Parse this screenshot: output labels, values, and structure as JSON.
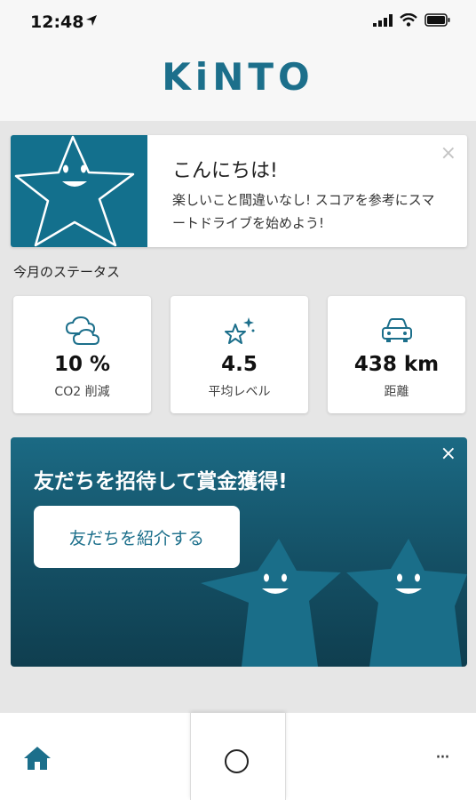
{
  "status_bar": {
    "time": "12:48"
  },
  "header": {
    "logo": "KiNTO"
  },
  "greeting": {
    "title": "こんにちは!",
    "message": "楽しいこと間違いなし! スコアを参考にスマートドライブを始めよう!",
    "close": "×"
  },
  "status": {
    "heading": "今月のステータス",
    "cards": [
      {
        "icon": "cloud-icon",
        "value": "10 %",
        "label": "CO2 削減"
      },
      {
        "icon": "sparkle-star-icon",
        "value": "4.5",
        "label": "平均レベル"
      },
      {
        "icon": "car-icon",
        "value": "438 km",
        "label": "距離"
      }
    ]
  },
  "invite": {
    "title": "友だちを招待して賞金獲得!",
    "button_label": "友だちを紹介する",
    "close": "×"
  },
  "tabbar": {
    "more": "···"
  },
  "colors": {
    "brand": "#1c6f8b",
    "card_teal": "#13708d",
    "banner_dark": "#0f3e4f"
  }
}
